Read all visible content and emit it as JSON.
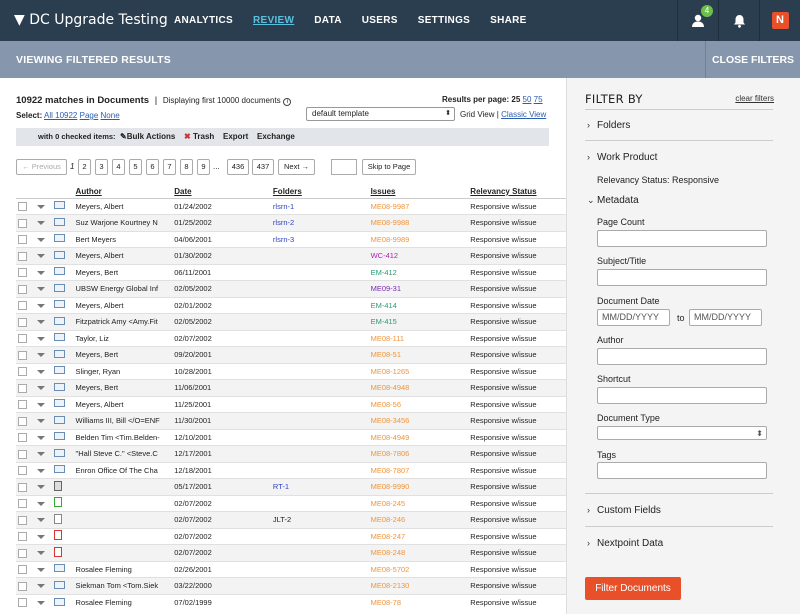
{
  "topbar": {
    "title": "DC Upgrade Testing",
    "nav": [
      "ANALYTICS",
      "REVIEW",
      "DATA",
      "USERS",
      "SETTINGS",
      "SHARE"
    ],
    "active_nav": "REVIEW",
    "badge": "4",
    "logo_letter": "N"
  },
  "filterbar": {
    "viewing": "VIEWING FILTERED RESULTS",
    "close": "CLOSE FILTERS"
  },
  "summary": {
    "matches": "10922 matches in Documents",
    "displaying": "Displaying first 10000 documents",
    "select_label": "Select:",
    "select_all": "All 10922",
    "select_page": "Page",
    "select_none": "None",
    "results_per_page_label": "Results per page:",
    "rpp_options": [
      "25",
      "50",
      "75"
    ],
    "template": "default template",
    "grid_view": "Grid View",
    "classic_view": "Classic View"
  },
  "toolbar": {
    "checked": "with 0 checked items:",
    "bulk": "Bulk Actions",
    "trash": "Trash",
    "export": "Export",
    "exchange": "Exchange"
  },
  "pagination": {
    "prev": "← Previous",
    "current": "1",
    "pages": [
      "2",
      "3",
      "4",
      "5",
      "6",
      "7",
      "8",
      "9"
    ],
    "ellipsis": "...",
    "last_pages": [
      "436",
      "437"
    ],
    "next": "Next →",
    "skip": "Skip to Page"
  },
  "columns": [
    "Author",
    "Date",
    "Folders",
    "Issues",
    "Relevancy Status"
  ],
  "rows": [
    {
      "icon": "email",
      "author": "Meyers, Albert",
      "date": "01/24/2002",
      "folder": "rlsrn-1",
      "issue": "ME08-9987",
      "issue_color": "#f0953a",
      "status": "Responsive w/issue"
    },
    {
      "icon": "email",
      "author": "Suz Warjone Kourtney N",
      "date": "01/25/2002",
      "folder": "rlsrn-2",
      "issue": "ME08-9988",
      "issue_color": "#f0953a",
      "status": "Responsive w/issue"
    },
    {
      "icon": "email",
      "author": "Bert Meyers",
      "date": "04/06/2001",
      "folder": "rlsrn-3",
      "issue": "ME08-9989",
      "issue_color": "#f0953a",
      "status": "Responsive w/issue"
    },
    {
      "icon": "email",
      "author": "Meyers, Albert",
      "date": "01/30/2002",
      "folder": "",
      "issue": "WC-412",
      "issue_color": "#b020c0",
      "status": "Responsive w/issue"
    },
    {
      "icon": "email",
      "author": "Meyers, Bert",
      "date": "06/11/2001",
      "folder": "",
      "issue": "EM-412",
      "issue_color": "#2a9a7a",
      "status": "Responsive w/issue"
    },
    {
      "icon": "email",
      "author": "UBSW Energy Global Inf",
      "date": "02/05/2002",
      "folder": "",
      "issue": "ME09-31",
      "issue_color": "#7a2ab0",
      "status": "Responsive w/issue"
    },
    {
      "icon": "email",
      "author": "Meyers, Albert",
      "date": "02/01/2002",
      "folder": "",
      "issue": "EM-414",
      "issue_color": "#2a9a7a",
      "status": "Responsive w/issue"
    },
    {
      "icon": "attach",
      "author": "Fitzpatrick Amy <Amy.Fit",
      "date": "02/05/2002",
      "folder": "",
      "issue": "EM-415",
      "issue_color": "#2a9a7a",
      "status": "Responsive w/issue"
    },
    {
      "icon": "attach",
      "author": "Taylor, Liz",
      "date": "02/07/2002",
      "folder": "",
      "issue": "ME08-111",
      "issue_color": "#f0953a",
      "status": "Responsive w/issue"
    },
    {
      "icon": "email",
      "author": "Meyers, Bert",
      "date": "09/20/2001",
      "folder": "",
      "issue": "ME08-51",
      "issue_color": "#f0953a",
      "status": "Responsive w/issue"
    },
    {
      "icon": "email",
      "author": "Slinger, Ryan",
      "date": "10/28/2001",
      "folder": "",
      "issue": "ME08-1265",
      "issue_color": "#f0953a",
      "status": "Responsive w/issue"
    },
    {
      "icon": "email",
      "author": "Meyers, Bert",
      "date": "11/06/2001",
      "folder": "",
      "issue": "ME08-4948",
      "issue_color": "#f0953a",
      "status": "Responsive w/issue"
    },
    {
      "icon": "email",
      "author": "Meyers, Albert",
      "date": "11/25/2001",
      "folder": "",
      "issue": "ME08-56",
      "issue_color": "#f0953a",
      "status": "Responsive w/issue"
    },
    {
      "icon": "email",
      "author": "Williams III, Bill </O=ENF",
      "date": "11/30/2001",
      "folder": "",
      "issue": "ME08-3456",
      "issue_color": "#f0953a",
      "status": "Responsive w/issue"
    },
    {
      "icon": "email",
      "author": "Belden Tim <Tim.Belden-",
      "date": "12/10/2001",
      "folder": "",
      "issue": "ME08-4949",
      "issue_color": "#f0953a",
      "status": "Responsive w/issue"
    },
    {
      "icon": "email",
      "author": "\"Hall Steve C.\" <Steve.C",
      "date": "12/17/2001",
      "folder": "",
      "issue": "ME08-7806",
      "issue_color": "#f0953a",
      "status": "Responsive w/issue"
    },
    {
      "icon": "email",
      "author": "Enron Office Of The Cha",
      "date": "12/18/2001",
      "folder": "",
      "issue": "ME08-7807",
      "issue_color": "#f0953a",
      "status": "Responsive w/issue"
    },
    {
      "icon": "img",
      "author": "",
      "date": "05/17/2001",
      "folder": "RT-1",
      "issue": "ME08-9990",
      "issue_color": "#f0953a",
      "status": "Responsive w/issue"
    },
    {
      "icon": "xls",
      "author": "",
      "date": "02/07/2002",
      "folder": "",
      "issue": "ME08-245",
      "issue_color": "#f0953a",
      "status": "Responsive w/issue"
    },
    {
      "icon": "doc",
      "author": "",
      "date": "02/07/2002",
      "folder": "JLT-2",
      "issue": "ME08-246",
      "issue_color": "#f0953a",
      "status": "Responsive w/issue"
    },
    {
      "icon": "pdf",
      "author": "",
      "date": "02/07/2002",
      "folder": "",
      "issue": "ME08-247",
      "issue_color": "#f0953a",
      "status": "Responsive w/issue"
    },
    {
      "icon": "pdf",
      "author": "",
      "date": "02/07/2002",
      "folder": "",
      "issue": "ME08-248",
      "issue_color": "#f0953a",
      "status": "Responsive w/issue"
    },
    {
      "icon": "email",
      "author": "Rosalee Fleming",
      "date": "02/26/2001",
      "folder": "",
      "issue": "ME08-5702",
      "issue_color": "#f0953a",
      "status": "Responsive w/issue"
    },
    {
      "icon": "email",
      "author": "Siekman Tom <Tom.Siek",
      "date": "03/22/2000",
      "folder": "",
      "issue": "ME08-2130",
      "issue_color": "#f0953a",
      "status": "Responsive w/issue"
    },
    {
      "icon": "email",
      "author": "Rosalee Fleming",
      "date": "07/02/1999",
      "folder": "",
      "issue": "ME08-78",
      "issue_color": "#f0953a",
      "status": "Responsive w/issue"
    }
  ],
  "sidebar": {
    "title": "FILTER BY",
    "clear": "clear filters",
    "folders": "Folders",
    "work_product": "Work Product",
    "relevancy": "Relevancy Status: Responsive",
    "metadata": "Metadata",
    "page_count": "Page Count",
    "subject": "Subject/Title",
    "doc_date": "Document Date",
    "date_placeholder": "MM/DD/YYYY",
    "to": "to",
    "author": "Author",
    "shortcut": "Shortcut",
    "doc_type": "Document Type",
    "tags": "Tags",
    "custom_fields": "Custom Fields",
    "nextpoint_data": "Nextpoint Data",
    "filter_btn": "Filter Documents"
  }
}
